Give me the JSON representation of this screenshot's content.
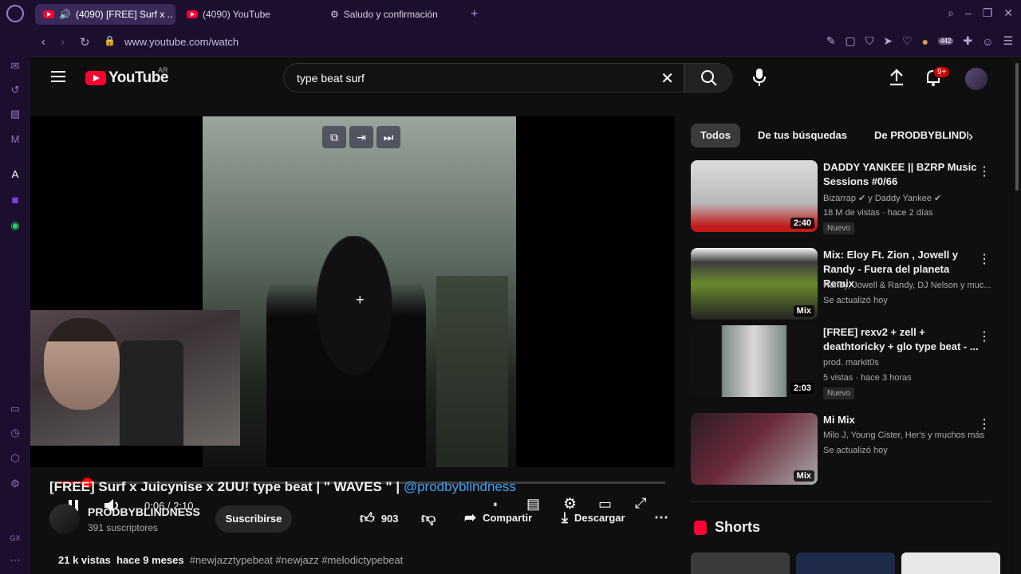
{
  "browser": {
    "tabs": [
      {
        "label": "(4090) [FREE] Surf x ..",
        "active": true
      },
      {
        "label": "(4090) YouTube",
        "active": false
      },
      {
        "label": "Saludo y confirmación",
        "active": false
      }
    ],
    "url": "www.youtube.com/watch",
    "ext_badge": "442"
  },
  "header": {
    "logo_text": "YouTube",
    "region": "AR",
    "search_value": "type beat  surf",
    "notif_badge": "9+"
  },
  "player": {
    "time": "0:06 / 2:10",
    "progress": 0.046
  },
  "video": {
    "title": "[FREE] Surf x Juicynise x 2UU! type beat | \" WAVES \" |",
    "mention": "@prodbyblindness",
    "channel": "PRODBYBLINDNESS",
    "subscribers": "391 suscriptores",
    "subscribe_label": "Suscribirse",
    "likes": "903",
    "share_label": "Compartir",
    "download_label": "Descargar",
    "views": "21 k vistas",
    "age": "hace 9 meses",
    "hashtags": "#newjazztypebeat #newjazz #melodictypebeat"
  },
  "chips": [
    "Todos",
    "De tus búsquedas",
    "De PRODBYBLINDN"
  ],
  "related": [
    {
      "title": "DADDY YANKEE || BZRP Music Sessions #0/66",
      "channel": "Bizarrap ✔ y Daddy Yankee ✔",
      "meta": "18 M de vistas · hace 2 días",
      "badge": "Nuevo",
      "duration": "2:40"
    },
    {
      "title": "Mix: Eloy Ft. Zion , Jowell y Randy - Fuera del planeta Remix",
      "channel": "Randy, Jowell & Randy, DJ Nelson y muc...",
      "meta": "Se actualizó hoy",
      "badge": "",
      "duration": "Mix"
    },
    {
      "title": "[FREE] rexv2 + zell + deathtoricky + glo type beat - ...",
      "channel": "prod. markit0s",
      "meta": "5 vistas · hace 3 horas",
      "badge": "Nuevo",
      "duration": "2:03"
    },
    {
      "title": "Mi Mix",
      "channel": "Milo J, Young Cister, Her's y muchos más",
      "meta": "Se actualizó hoy",
      "badge": "",
      "duration": "Mix"
    }
  ],
  "shorts": {
    "label": "Shorts"
  }
}
